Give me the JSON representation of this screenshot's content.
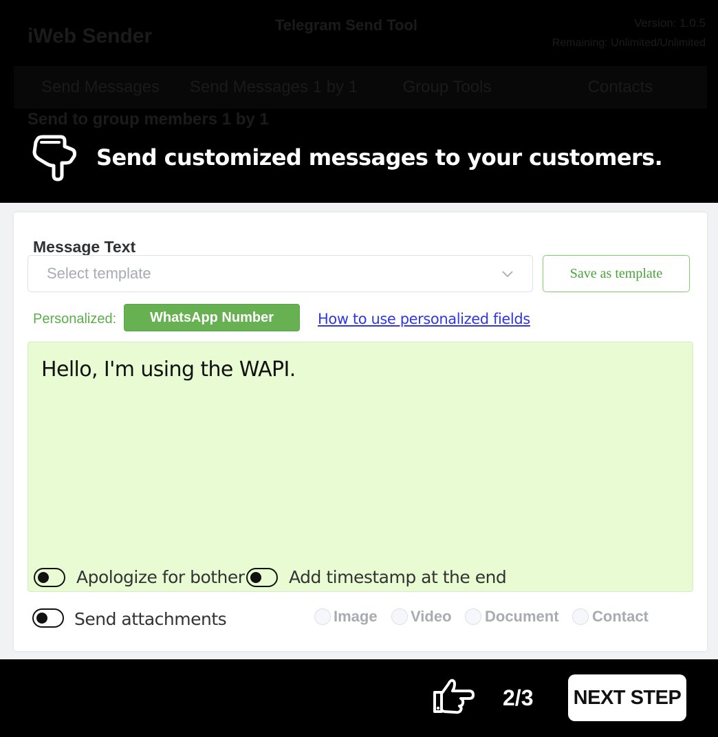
{
  "app": {
    "logo": "iWeb Sender",
    "title": "Telegram Send Tool",
    "version": "Version: 1.0.5",
    "license": "Remaining: Unlimited/Unlimited",
    "tabs": [
      "Send Messages",
      "Send Messages 1 by 1",
      "Group Tools",
      "Contacts"
    ],
    "subtitle": "Send to group members 1 by 1"
  },
  "tour": {
    "hint": "Send customized messages to your customers.",
    "step": "2/3",
    "next_label": "NEXT STEP"
  },
  "form": {
    "message_label": "Message Text",
    "template_placeholder": "Select template",
    "save_template_label": "Save as template",
    "personalized_label": "Personalized:",
    "personalized_field": "WhatsApp Number",
    "howto_link": "How to use personalized fields",
    "message_text": "Hello, I'm using the WAPI.",
    "options": {
      "apologize": "Apologize for bother",
      "timestamp": "Add timestamp at the end",
      "attachments": "Send attachments"
    },
    "attachment_types": [
      "Image",
      "Video",
      "Document",
      "Contact"
    ]
  },
  "colors": {
    "accent_green": "#67b153",
    "message_bg": "#e8fbd3",
    "link_blue": "#2f35e8"
  }
}
